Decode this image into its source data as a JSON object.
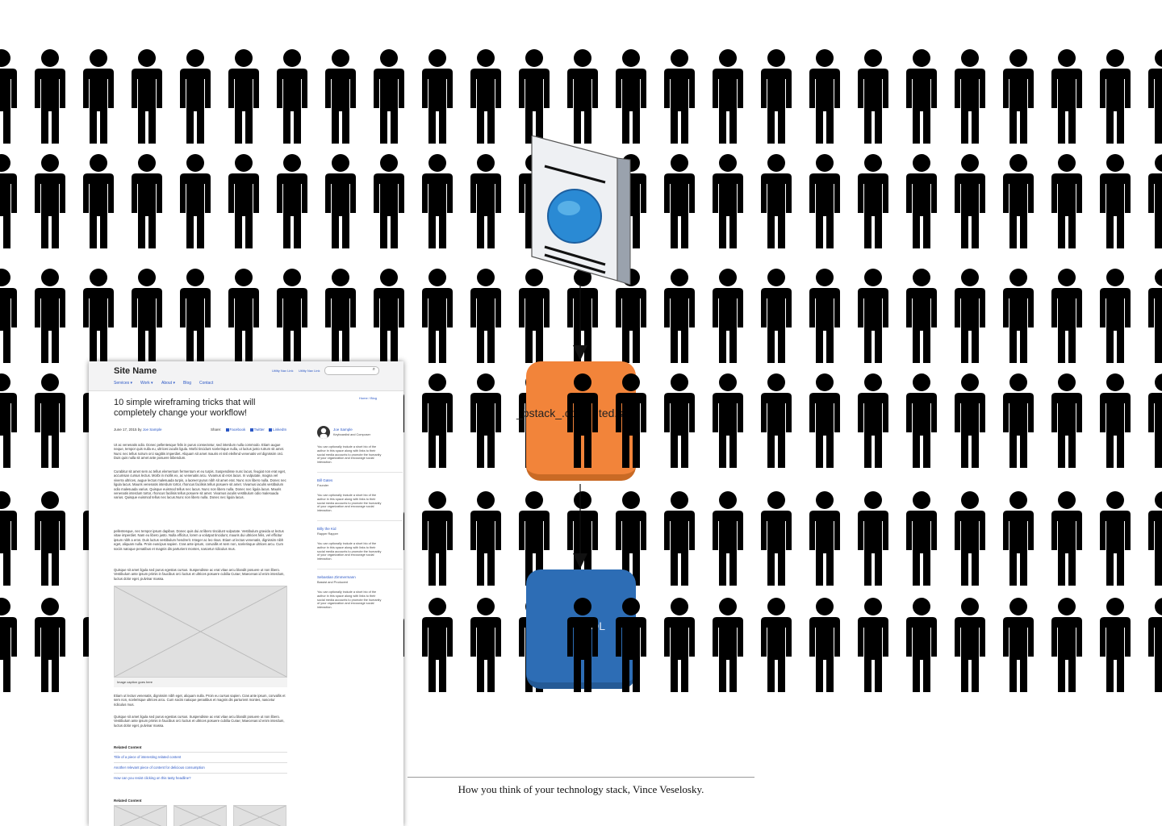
{
  "diagram": {
    "orange_box_label": "_bstack_.com/...ted.svg",
    "blue_box_label": "SQL",
    "caption": "How you think of your technology stack, Vince Veselosky.",
    "colors": {
      "people": "#000000",
      "orange_box": "#f2843a",
      "blue_box": "#2d6db5",
      "globe": "#2a8ad4",
      "document": "#e6e8ec"
    },
    "icons": [
      "person-icon",
      "document-globe-icon",
      "arrow-down-icon"
    ]
  },
  "wireframe": {
    "site_name": "Site Name",
    "nav": [
      "Services ▾",
      "Work ▾",
      "About ▾",
      "Blog",
      "Contact"
    ],
    "utility_links": [
      "Utility Nav Link",
      "Utility Nav Link"
    ],
    "search_icon": "⌕",
    "breadcrumb": "Home / Blog",
    "article_title": "10 simple wireframing tricks that will completely change your workflow!",
    "meta_date": "June 17, 2015 by ",
    "meta_author": "Joe Sample",
    "share_label": "Share:",
    "share_links": [
      "Facebook",
      "Twitter",
      "LinkedIn"
    ],
    "paragraphs": [
      "Ut ac venenatis odio. Donec pellentesque felis in purus consectetur, sed interdum nulla commodo. Etiam augue neque, tempor quis nulla eu, ultrices iaculis ligula. Morbi tincidunt scelerisque nulla, ut luctus justo rutrum sit amet. Nunc nec tellus rutrum orci sagittis imperdiet. Aliquam sit amet mauris et nisl eleifend venenatis vel dignissim orci. Duis quis nulla sit amet ante posuere bibendum.",
      "Curabitur sit amet sem ac tellus elementum fermentum et eu turpis. Suspendisse nunc lacus, feugiat non erat eget, accumsan cursus lectus. Morbi in mollis ex, ac venenatis arcu. Vivamus id eros lacus. In vulputate, magna vel viverra ultrices, augue lectus malesuada turpis, a laoreet purus nibh sit amet erat. Nunc non libero nulla. Donec nec ligula lacus. Mauris venenatis interdum tortor, rhoncus facilisis tellus posuere sit amet. Vivamus iaculis vestibulum odio malesuada varius. Quisque euismod tellus nec lacus. Nunc non libero nulla. Donec nec ligula lacus. Mauris venenatis interdum tortor, rhoncus facilisis tellus posuere sit amet. Vivamus iaculis vestibulum odio malesuada varius. Quisque euismod tellus nec lacus.Nunc non libero nulla. Donec nec ligula lacus.",
      "pellentesque, nec tempor ipsum dapibus. Donec quis dui at libero tincidunt vulputate. Vestibulum gravida ut lectus vitae imperdiet. Nam eu libero justo. Nulla efficitur, lorem a volutpat tincidunt, mauris dui ultricies felis, vel efficitur ipsum nibh a eros. Duis luctus vestibulum hendrerit. Integer ac leo risus. Etiam ut lectus venenatis, dignissim nibh eget, aliquam nulla. Proin euscipus sapien. Cras ante ipsum, convallis et sem non, scelerisque ultrices arcu. Cum sociis natoque penatibus et magnis dis parturient montes, nascetur ridiculus mus.",
      "Quisque sit amet ligula sed purus egestas cursus. Suspendisse ac erat vitae arcu blandit posuere ut non libero. Vestibulum ante ipsum primis in faucibus orci luctus et ultrices posuere cubilia Curae; Maecenas id enim interdum, luctus dolor eget, pulvinar massa.",
      "Etiam ut lectus venenatis, dignissim nibh eget, aliquam nulla. Proin eu cursus sapien. Cras ante ipsum, convallis et sem non, scelerisque ultrices arcu. Cum sociis natoque penatibus et magnis dis parturient montes, nascetur ridiculus mus.",
      "Quisque sit amet ligula sed purus egestas cursus. Suspendisse ac erat vitae arcu blandit posuere ut non libero. Vestibulum ante ipsum primis in faucibus orci luctus et ultrices posuere cubilia Curae; Maecenas id enim interdum, luctus dolor eget, pulvinar massa."
    ],
    "image_caption": "Image caption goes here",
    "related_heading": "Related Content",
    "related_links": [
      "Title of a piece of interesting related content",
      "Another relevant piece of content for delicious consumption",
      "How can you resist clicking on this tasty headline?"
    ],
    "related_heading_2": "Related Content",
    "sidebar": [
      {
        "name": "Joe Sample",
        "role": "Keyboardist and Composer",
        "bio": "You can optionally include a short bio of the author in this space along with links to their social media accounts to promote the humanity of your organization and encourage social interaction."
      },
      {
        "name": "Bill Gates",
        "role": "Founder",
        "bio": "You can optionally include a short bio of the author in this space along with links to their social media accounts to promote the humanity of your organization and encourage social interaction."
      },
      {
        "name": "Billy the Kid",
        "role": "Rapper Rapper",
        "bio": "You can optionally include a short bio of the author in this space along with links to their social media accounts to promote the humanity of your organization and encourage social interaction."
      },
      {
        "name": "Sebastian Zimmermann",
        "role": "Bassist and Producent",
        "bio": "You can optionally include a short bio of the author in this space along with links to their social media accounts to promote the humanity of your organization and encourage social interaction."
      }
    ]
  }
}
